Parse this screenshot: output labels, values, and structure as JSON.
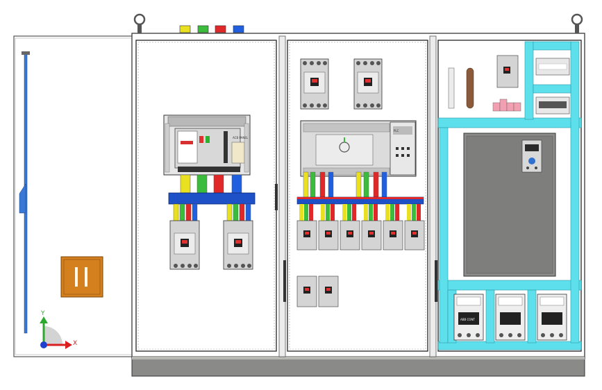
{
  "axes": {
    "y_label": "Y",
    "x_label": "X"
  },
  "panel_labels": {
    "acb_tag": "ACB PANEL",
    "contactor_tag": "ABB CONT",
    "plc_tag": "PLC"
  },
  "colors": {
    "phase_l1": "#e8e020",
    "phase_l2": "#3cbc3c",
    "phase_l3": "#e02828",
    "neutral": "#2060e0",
    "busbar": "#1e50c8",
    "cyan_duct": "#5ee0ec",
    "terminal_pink": "#f0a0b0",
    "door_handle": "#d4801e"
  },
  "icons": {
    "lifting_eye": "ring-icon",
    "axis_triad": "xyz-axis-icon"
  }
}
